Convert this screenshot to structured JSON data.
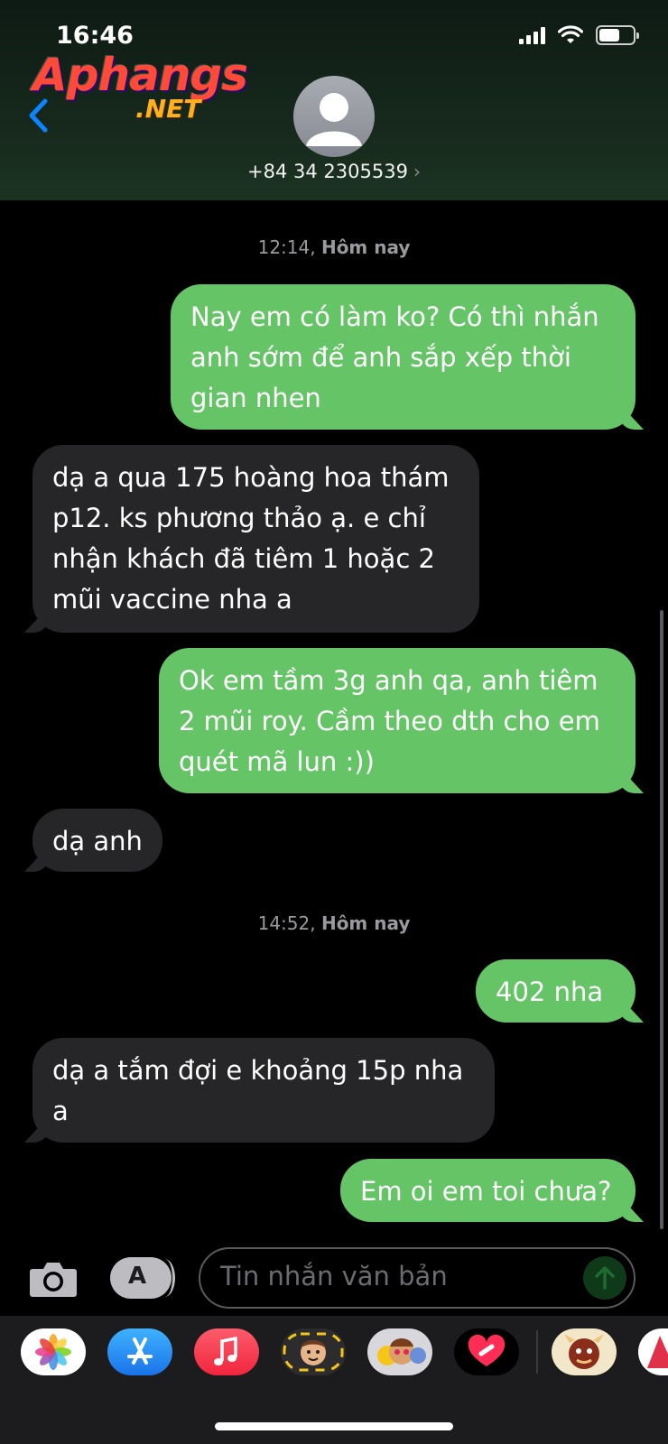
{
  "status_bar": {
    "time": "16:46"
  },
  "watermark": {
    "main": "Aphangs",
    "net": ".NET"
  },
  "contact": {
    "name": "+84 34 2305539",
    "chevron": "›"
  },
  "conversation": [
    {
      "type": "timestamp",
      "time": "12:14,",
      "day": "Hôm nay"
    },
    {
      "type": "outgoing",
      "text": "Nay em có làm ko? Có thì nhắn anh sớm để anh sắp xếp thời gian nhen"
    },
    {
      "type": "incoming",
      "text": "dạ a qua 175 hoàng hoa thám p12. ks phương thảo ạ. e chỉ nhận khách đã tiêm 1 hoặc 2 mũi vaccine nha a"
    },
    {
      "type": "outgoing",
      "text": "Ok em tầm 3g anh qa, anh tiêm 2 mũi roy. Cầm theo dth cho em quét mã lun :))"
    },
    {
      "type": "incoming",
      "text": "dạ anh"
    },
    {
      "type": "timestamp",
      "time": "14:52,",
      "day": "Hôm nay"
    },
    {
      "type": "outgoing",
      "text": "402 nha"
    },
    {
      "type": "incoming",
      "text": "dạ a tắm đợi e khoảng 15p nha a"
    },
    {
      "type": "outgoing",
      "text": "Em oi em toi chưa?"
    }
  ],
  "composer": {
    "placeholder": "Tin nhắn văn bản"
  },
  "colors": {
    "outgoing_bubble": "#65c466",
    "incoming_bubble": "#262628",
    "accent": "#0a84ff"
  },
  "app_drawer": [
    {
      "icon": "photos-icon"
    },
    {
      "icon": "app-store-icon"
    },
    {
      "icon": "music-icon"
    },
    {
      "icon": "memoji-stickers-icon"
    },
    {
      "icon": "animoji-icon"
    },
    {
      "icon": "digital-touch-icon"
    },
    {
      "icon": "sticker-app-icon"
    },
    {
      "icon": "partial-app-icon"
    }
  ]
}
